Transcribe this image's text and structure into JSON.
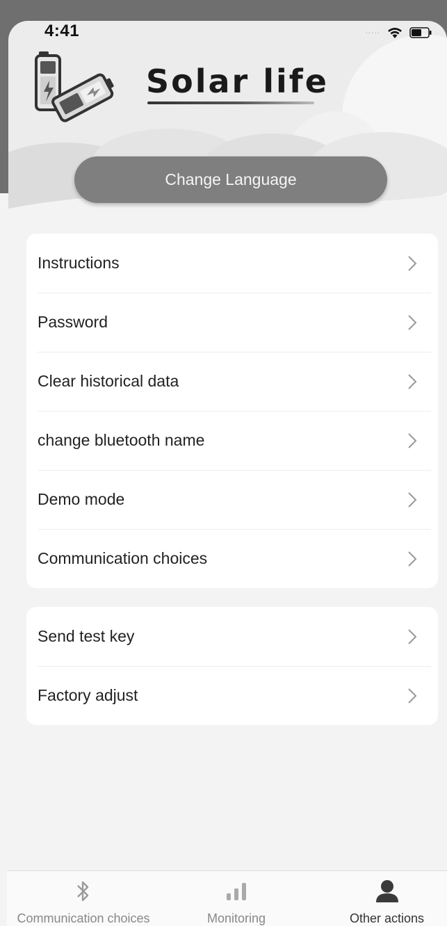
{
  "status_bar": {
    "time": "4:41",
    "signal_dots": "·····",
    "wifi_icon": "wifi-icon",
    "battery_icon": "battery-icon"
  },
  "header": {
    "brand_title": "Solar life",
    "language_button_label": "Change Language",
    "illustration_icon": "battery-charging-icon"
  },
  "menu_groups": [
    {
      "items": [
        {
          "label": "Instructions"
        },
        {
          "label": "Password"
        },
        {
          "label": "Clear historical data"
        },
        {
          "label": "change bluetooth name"
        },
        {
          "label": "Demo mode"
        },
        {
          "label": "Communication choices"
        }
      ]
    },
    {
      "items": [
        {
          "label": "Send test key"
        },
        {
          "label": "Factory adjust"
        }
      ]
    }
  ],
  "tab_bar": {
    "tabs": [
      {
        "label": "Communication choices",
        "icon": "bluetooth-icon",
        "active": false
      },
      {
        "label": "Monitoring",
        "icon": "bar-chart-icon",
        "active": false
      },
      {
        "label": "Other actions",
        "icon": "person-icon",
        "active": true
      }
    ]
  },
  "colors": {
    "background": "#f3f3f3",
    "card": "#ffffff",
    "button": "#7f7f7f",
    "text": "#222222",
    "inactive_tab": "#888888"
  }
}
